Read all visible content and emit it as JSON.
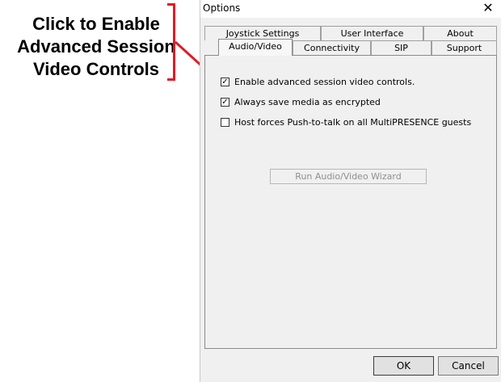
{
  "annotation": {
    "lines": [
      "Click to Enable",
      "Advanced Session",
      "Video Controls"
    ],
    "color": "#e01b24"
  },
  "dialog": {
    "title": "Options",
    "close_icon": "close-icon",
    "tabs_row1": [
      "Joystick Settings",
      "User Interface",
      "About"
    ],
    "tabs_row2": [
      "Audio/Video",
      "Connectivity",
      "SIP",
      "Support"
    ],
    "active_tab": "Audio/Video",
    "options": [
      {
        "label": "Enable advanced session video controls.",
        "checked": true
      },
      {
        "label": "Always save media as encrypted",
        "checked": true
      },
      {
        "label": "Host forces Push-to-talk on all MultiPRESENCE guests",
        "checked": false
      }
    ],
    "wizard_button": "Run Audio/Video Wizard",
    "ok_label": "OK",
    "cancel_label": "Cancel"
  }
}
